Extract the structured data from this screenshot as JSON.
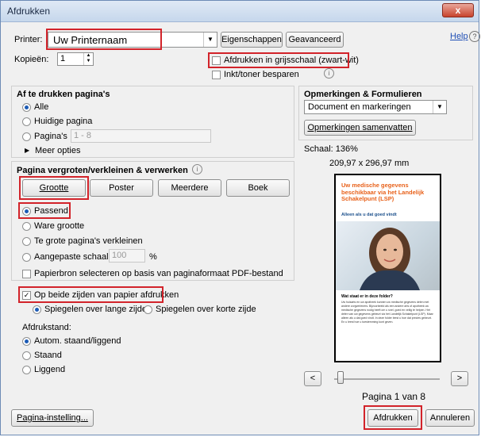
{
  "window": {
    "title": "Afdrukken",
    "close_glyph": "x"
  },
  "printer": {
    "label": "Printer:",
    "value": "Uw Printernaam",
    "properties_button": "Eigenschappen",
    "advanced_button": "Geavanceerd",
    "help_link": "Help"
  },
  "copies": {
    "label": "Kopieën:",
    "value": "1"
  },
  "options": {
    "grayscale": "Afdrukken in grijsschaal (zwart-wit)",
    "save_ink": "Inkt/toner besparen"
  },
  "pages_to_print": {
    "heading": "Af te drukken pagina's",
    "all": "Alle",
    "current": "Huidige pagina",
    "pages": "Pagina's",
    "pages_value": "1 - 8",
    "more": "Meer opties"
  },
  "page_sizing": {
    "heading": "Pagina vergroten/verkleinen & verwerken",
    "tabs": [
      "Grootte",
      "Poster",
      "Meerdere",
      "Boek"
    ],
    "fit": "Passend",
    "actual": "Ware grootte",
    "shrink": "Te grote pagina's verkleinen",
    "custom": "Aangepaste schaal:",
    "custom_value": "100",
    "custom_unit": "%",
    "paper_source": "Papierbron selecteren op basis van paginaformaat PDF-bestand"
  },
  "duplex": {
    "label": "Op beide zijden van papier afdrukken",
    "long_edge": "Spiegelen over lange zijde",
    "short_edge": "Spiegelen over korte zijde"
  },
  "orientation": {
    "heading": "Afdrukstand:",
    "auto": "Autom. staand/liggend",
    "portrait": "Staand",
    "landscape": "Liggend"
  },
  "comments": {
    "heading": "Opmerkingen & Formulieren",
    "select_value": "Document en markeringen",
    "summarize_button": "Opmerkingen samenvatten"
  },
  "preview": {
    "scale": "Schaal: 136%",
    "dimensions": "209,97 x 296,97 mm",
    "doc_title": "Uw medische gegevens beschikbaar via het Landelijk Schakelpunt (LSP)",
    "doc_subtitle": "Alleen als u dat goed vindt",
    "doc_section": "Wat staat er in deze folder?",
    "doc_body": "Uw huisarts en uw apotheek kunnen uw medische gegevens delen met andere zorgverleners. Bijvoorbeeld als een andere arts of apotheek uw medische gegevens nodig heeft om u snel, goed en veilig te helpen. Het delen van uw gegevens gebeurt via het Landelijk Schakelpunt (LSP). Maar alleen als u dat goed vindt. In deze folder leest u hoe dat precies gebeurt. En u leest hoe u toestemming kunt geven.",
    "page_info": "Pagina 1 van 8",
    "slider_fraction": 0.0
  },
  "footer": {
    "page_setup": "Pagina-instelling...",
    "print": "Afdrukken",
    "cancel": "Annuleren"
  },
  "colors": {
    "highlight": "#d2232a",
    "doc_accent": "#e8611a",
    "doc_title": "#e8611a"
  }
}
